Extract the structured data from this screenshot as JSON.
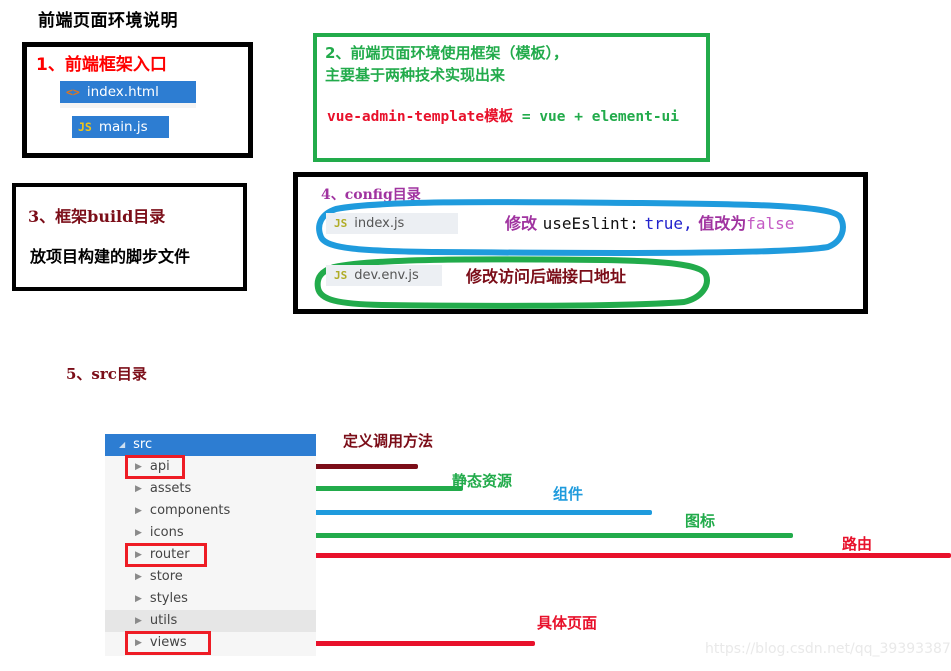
{
  "page": {
    "title": "前端页面环境说明",
    "watermark": "https://blog.csdn.net/qq_39393387"
  },
  "colors": {
    "red": "#ff0000",
    "bright_red": "#e8112b",
    "dark_red": "#7b0d18",
    "green": "#22ab4b",
    "blue": "#2d7dd2",
    "sky_blue": "#1f9bdd",
    "purple": "#a033a0",
    "pink": "#c45ac4",
    "code_blue": "#2222cc",
    "black": "#000000",
    "tree_bg": "#f6f6f6",
    "chip_grey": "#eceff3",
    "watermark_grey": "#e9e9e9"
  },
  "box_entry": {
    "heading": "1、前端框架入口",
    "files": [
      {
        "icon": "<>",
        "icon_name": "html-file-icon",
        "label": "index.html"
      },
      {
        "icon": "JS",
        "icon_name": "js-file-icon",
        "label": "main.js"
      }
    ]
  },
  "box_framework": {
    "heading_line1": "2、前端页面环境使用框架（模板），",
    "heading_line2": "主要基于两种技术实现出来",
    "formula_template": "vue-admin-template模板",
    "formula_rest": " = vue + element-ui"
  },
  "box_build": {
    "heading": "3、框架build目录",
    "body": "放项目构建的脚步文件"
  },
  "box_config": {
    "heading": "4、config目录",
    "files": [
      {
        "icon": "JS",
        "icon_name": "js-file-icon",
        "label": "index.js"
      },
      {
        "icon": "JS",
        "icon_name": "js-file-icon",
        "label": "dev.env.js"
      }
    ],
    "annotation_eslint": {
      "part1": "修改",
      "part2": "useEslint:",
      "part3": "true,",
      "part4": "值改为",
      "part5": "false"
    },
    "annotation_backend": "修改访问后端接口地址"
  },
  "src_section": {
    "heading": "5、src目录",
    "tree": {
      "root": {
        "label": "src",
        "caret": "◢"
      },
      "children": [
        {
          "label": "api",
          "caret": "▶",
          "highlighted": true,
          "hover": false
        },
        {
          "label": "assets",
          "caret": "▶",
          "highlighted": false,
          "hover": false
        },
        {
          "label": "components",
          "caret": "▶",
          "highlighted": false,
          "hover": false
        },
        {
          "label": "icons",
          "caret": "▶",
          "highlighted": false,
          "hover": false
        },
        {
          "label": "router",
          "caret": "▶",
          "highlighted": true,
          "hover": false
        },
        {
          "label": "store",
          "caret": "▶",
          "highlighted": false,
          "hover": false
        },
        {
          "label": "styles",
          "caret": "▶",
          "highlighted": false,
          "hover": false
        },
        {
          "label": "utils",
          "caret": "▶",
          "highlighted": false,
          "hover": true
        },
        {
          "label": "views",
          "caret": "▶",
          "highlighted": true,
          "hover": false
        }
      ]
    },
    "annotations": [
      {
        "target": "api",
        "label": "定义调用方法",
        "color": "#7b0d18"
      },
      {
        "target": "assets",
        "label": "静态资源",
        "color": "#22ab4b"
      },
      {
        "target": "components",
        "label": "组件",
        "color": "#1f9bdd"
      },
      {
        "target": "icons",
        "label": "图标",
        "color": "#22ab4b"
      },
      {
        "target": "router",
        "label": "路由",
        "color": "#e8112b"
      },
      {
        "target": "views",
        "label": "具体页面",
        "color": "#e8112b"
      }
    ]
  }
}
